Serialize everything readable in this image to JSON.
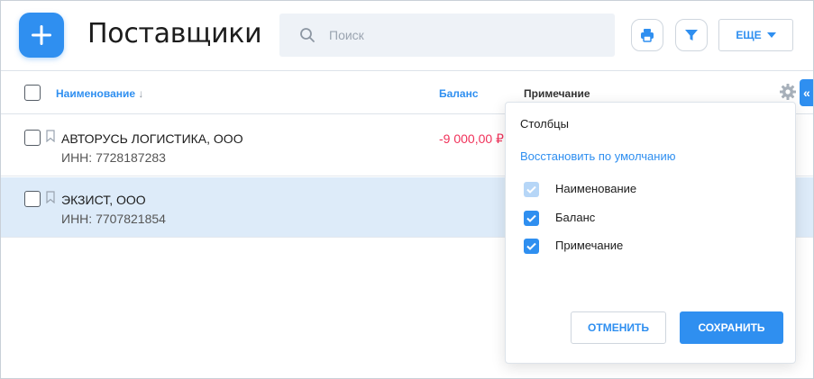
{
  "header": {
    "title": "Поставщики",
    "search_placeholder": "Поиск",
    "more_label": "ЕЩЕ"
  },
  "table": {
    "columns": {
      "name": "Наименование",
      "sort_indicator": "↓",
      "balance": "Баланс",
      "note": "Примечание"
    },
    "rows": [
      {
        "name": "АВТОРУСЬ ЛОГИСТИКА, ООО",
        "inn": "ИНН: 7728187283",
        "balance": "-9 000,00 ₽",
        "selected": false
      },
      {
        "name": "ЭКЗИСТ, ООО",
        "inn": "ИНН: 7707821854",
        "balance": "",
        "selected": true
      }
    ]
  },
  "columns_popup": {
    "title": "Столбцы",
    "reset_label": "Восстановить по умолчанию",
    "options": [
      {
        "label": "Наименование",
        "checked": true,
        "disabled": true
      },
      {
        "label": "Баланс",
        "checked": true,
        "disabled": false
      },
      {
        "label": "Примечание",
        "checked": true,
        "disabled": false
      }
    ],
    "cancel_label": "ОТМЕНИТЬ",
    "save_label": "СОХРАНИТЬ"
  },
  "collapse_label": "«",
  "colors": {
    "accent": "#2f8ff0",
    "negative": "#f0325a",
    "selected_row": "#ddebf9"
  }
}
